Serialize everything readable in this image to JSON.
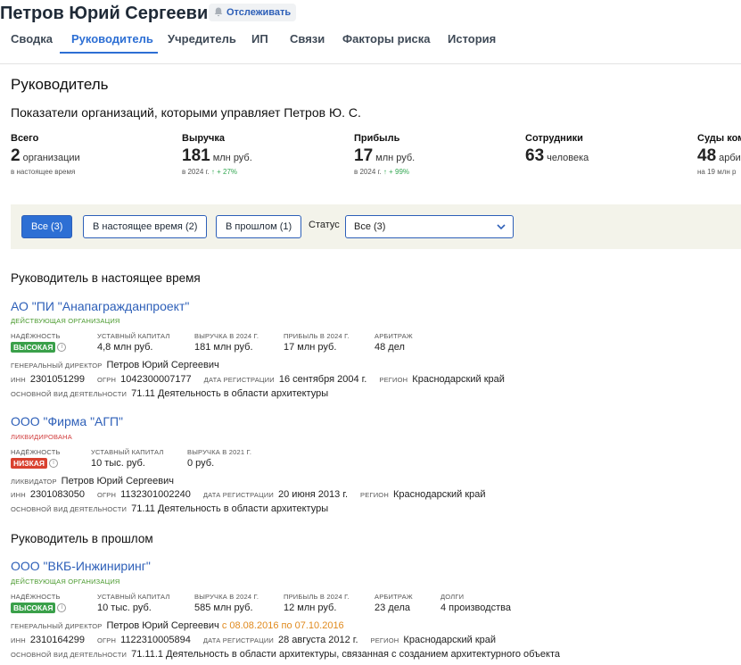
{
  "header": {
    "person_name": "Петров Юрий Сергеевич",
    "track_label": "Отслеживать"
  },
  "tabs": [
    "Сводка",
    "Руководитель",
    "Учредитель",
    "ИП",
    "Связи",
    "Факторы риска",
    "История"
  ],
  "active_tab": "Руководитель",
  "page": {
    "title": "Руководитель",
    "subtitle": "Показатели организаций, которыми управляет Петров Ю. С."
  },
  "stats": [
    {
      "label": "Всего",
      "value": "2",
      "unit": "организации",
      "sub": "в настоящее время",
      "delta": ""
    },
    {
      "label": "Выручка",
      "value": "181",
      "unit": "млн руб.",
      "sub": "в 2024 г.",
      "delta": "↑ + 27%"
    },
    {
      "label": "Прибыль",
      "value": "17",
      "unit": "млн руб.",
      "sub": "в 2024 г.",
      "delta": "↑ + 99%"
    },
    {
      "label": "Сотрудники",
      "value": "63",
      "unit": "человека",
      "sub": "",
      "delta": ""
    },
    {
      "label": "Суды ком",
      "value": "48",
      "unit": "арби",
      "sub": "на 19 млн р",
      "delta": ""
    }
  ],
  "filters": {
    "buttons": [
      "Все (3)",
      "В настоящее время (2)",
      "В прошлом (1)"
    ],
    "status_label": "Статус",
    "status_value": "Все (3)"
  },
  "sections": {
    "current": "Руководитель в настоящее время",
    "past": "Руководитель в прошлом"
  },
  "orgs": [
    {
      "name": "АО \"ПИ \"Анапагражданпроект\"",
      "status": "ДЕЙСТВУЮЩАЯ ОРГАНИЗАЦИЯ",
      "cols": [
        {
          "k": "НАДЁЖНОСТЬ",
          "v": "ВЫСОКАЯ"
        },
        {
          "k": "УСТАВНЫЙ КАПИТАЛ",
          "v": "4,8 млн руб."
        },
        {
          "k": "ВЫРУЧКА В 2024 Г.",
          "v": "181 млн руб."
        },
        {
          "k": "ПРИБЫЛЬ В 2024 Г.",
          "v": "17 млн руб."
        },
        {
          "k": "АРБИТРАЖ",
          "v": "48 дел"
        }
      ],
      "role_label": "ГЕНЕРАЛЬНЫЙ ДИРЕКТОР",
      "role_value": "Петров Юрий Сергеевич",
      "role_period": "",
      "inn": "2301051299",
      "ogrn": "1042300007177",
      "reg_date": "16 сентября 2004 г.",
      "region": "Краснодарский край",
      "activity": "71.11 Деятельность в области архитектуры"
    },
    {
      "name": "ООО \"Фирма \"АГП\"",
      "status": "ЛИКВИДИРОВАНА",
      "cols": [
        {
          "k": "НАДЁЖНОСТЬ",
          "v": "НИЗКАЯ"
        },
        {
          "k": "УСТАВНЫЙ КАПИТАЛ",
          "v": "10 тыс. руб."
        },
        {
          "k": "ВЫРУЧКА В 2021 Г.",
          "v": "0 руб."
        }
      ],
      "role_label": "ЛИКВИДАТОР",
      "role_value": "Петров Юрий Сергеевич",
      "role_period": "",
      "inn": "2301083050",
      "ogrn": "1132301002240",
      "reg_date": "20 июня 2013 г.",
      "region": "Краснодарский край",
      "activity": "71.11 Деятельность в области архитектуры"
    },
    {
      "name": "ООО \"ВКБ-Инжиниринг\"",
      "status": "ДЕЙСТВУЮЩАЯ ОРГАНИЗАЦИЯ",
      "cols": [
        {
          "k": "НАДЁЖНОСТЬ",
          "v": "ВЫСОКАЯ"
        },
        {
          "k": "УСТАВНЫЙ КАПИТАЛ",
          "v": "10 тыс. руб."
        },
        {
          "k": "ВЫРУЧКА В 2024 Г.",
          "v": "585 млн руб."
        },
        {
          "k": "ПРИБЫЛЬ В 2024 Г.",
          "v": "12 млн руб."
        },
        {
          "k": "АРБИТРАЖ",
          "v": "23 дела"
        },
        {
          "k": "ДОЛГИ",
          "v": "4 производства"
        }
      ],
      "role_label": "ГЕНЕРАЛЬНЫЙ ДИРЕКТОР",
      "role_value": "Петров Юрий Сергеевич",
      "role_period": "с 08.08.2016 по 07.10.2016",
      "inn": "2310164299",
      "ogrn": "1122310005894",
      "reg_date": "28 августа 2012 г.",
      "region": "Краснодарский край",
      "activity": "71.11.1 Деятельность в области архитектуры, связанная с созданием архитектурного объекта"
    }
  ],
  "labels": {
    "inn": "ИНН",
    "ogrn": "ОГРН",
    "reg_date": "ДАТА РЕГИСТРАЦИИ",
    "region": "РЕГИОН",
    "activity": "ОСНОВНОЙ ВИД ДЕЯТЕЛЬНОСТИ"
  },
  "colors": {
    "accent": "#2d6fd4",
    "link": "#2d5fb8",
    "high": "#3aa04a",
    "low": "#d9412f",
    "period": "#e08a1e"
  },
  "icons": [
    "bell-icon",
    "chevron-down-icon",
    "info-icon",
    "arrow-up-icon"
  ]
}
